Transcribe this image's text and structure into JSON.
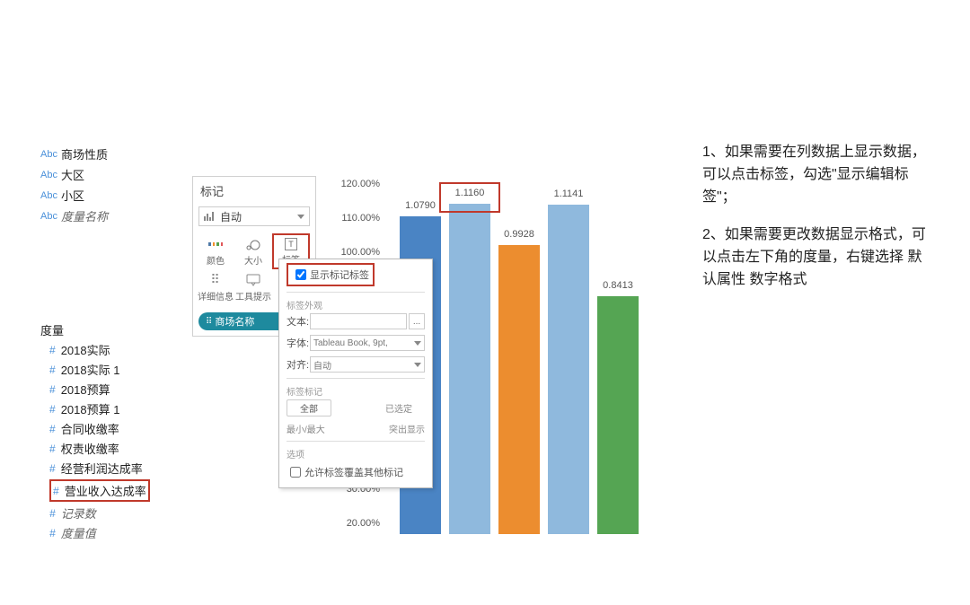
{
  "dims": {
    "d1": "商场性质",
    "d2": "大区",
    "d3": "小区",
    "d4": "度量名称",
    "abc": "Abc"
  },
  "measures_header": "度量",
  "hash": "#",
  "measures": {
    "m1": "2018实际",
    "m2": "2018实际 1",
    "m3": "2018预算",
    "m4": "2018预算 1",
    "m5": "合同收缴率",
    "m6": "权责收缴率",
    "m7": "经营利润达成率",
    "m8": "营业收入达成率",
    "m9": "记录数",
    "m10": "度量值"
  },
  "marks": {
    "title": "标记",
    "dropdown": "自动",
    "c_color": "颜色",
    "c_size": "大小",
    "c_label": "标签",
    "c_detail": "详细信息",
    "c_tooltip": "工具提示",
    "pill": "商场名称",
    "label_letter": "T"
  },
  "popup": {
    "cb_show": "显示标记标签",
    "appearance": "标签外观",
    "text": "文本:",
    "font": "字体:",
    "font_val": "Tableau Book, 9pt,",
    "align": "对齐:",
    "align_val": "自动",
    "marks": "标签标记",
    "all": "全部",
    "selected": "已选定",
    "minmax": "最小/最大",
    "highlight": "突出显示",
    "options": "选项",
    "overlap": "允许标签覆盖其他标记",
    "ellipsis": "..."
  },
  "instr": {
    "p1": "1、如果需要在列数据上显示数据，可以点击标签，勾选\"显示编辑标签\"；",
    "p2": "2、如果需要更改数据显示格式，可以点击左下角的度量，右键选择 默认属性 数字格式"
  },
  "chart_data": {
    "type": "bar",
    "ylabels": [
      "120.00%",
      "110.00%",
      "100.00%",
      "30.00%",
      "20.00%"
    ],
    "bars": [
      {
        "value": 1.079,
        "label": "1.0790",
        "color": "col1"
      },
      {
        "value": 1.116,
        "label": "1.1160",
        "color": "col2"
      },
      {
        "value": 0.9928,
        "label": "0.9928",
        "color": "col3"
      },
      {
        "value": 1.1141,
        "label": "1.1141",
        "color": "col4"
      },
      {
        "value": 0.8413,
        "label": "0.8413",
        "color": "col5"
      }
    ]
  }
}
